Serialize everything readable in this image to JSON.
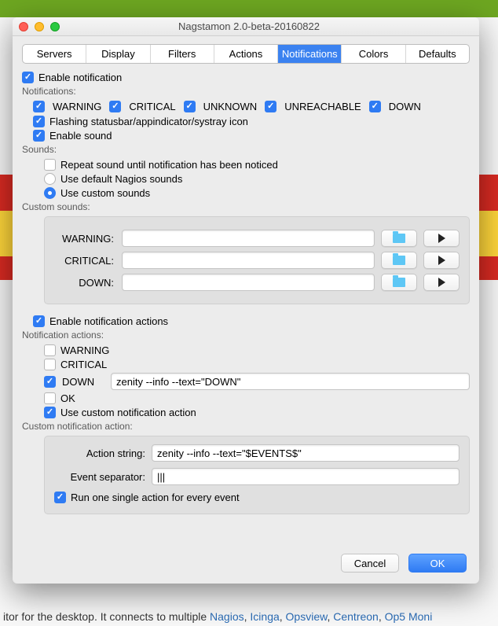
{
  "window_title": "Nagstamon 2.0-beta-20160822",
  "tabs": [
    "Servers",
    "Display",
    "Filters",
    "Actions",
    "Notifications",
    "Colors",
    "Defaults"
  ],
  "active_tab": "Notifications",
  "enable_notification": {
    "checked": true,
    "label": "Enable notification"
  },
  "notifications_header": "Notifications:",
  "levels": [
    {
      "key": "warning",
      "label": "WARNING",
      "checked": true
    },
    {
      "key": "critical",
      "label": "CRITICAL",
      "checked": true
    },
    {
      "key": "unknown",
      "label": "UNKNOWN",
      "checked": true
    },
    {
      "key": "unreachable",
      "label": "UNREACHABLE",
      "checked": true
    },
    {
      "key": "down",
      "label": "DOWN",
      "checked": true
    }
  ],
  "flashing": {
    "checked": true,
    "label": "Flashing statusbar/appindicator/systray icon"
  },
  "enable_sound": {
    "checked": true,
    "label": "Enable sound"
  },
  "sounds_header": "Sounds:",
  "repeat_sound": {
    "checked": false,
    "label": "Repeat sound until notification has been noticed"
  },
  "sound_mode": {
    "default": {
      "selected": false,
      "label": "Use default Nagios sounds"
    },
    "custom": {
      "selected": true,
      "label": "Use custom sounds"
    }
  },
  "custom_sounds_header": "Custom sounds:",
  "sounds": {
    "warning": {
      "label": "WARNING:",
      "value": ""
    },
    "critical": {
      "label": "CRITICAL:",
      "value": ""
    },
    "down": {
      "label": "DOWN:",
      "value": ""
    }
  },
  "enable_actions": {
    "checked": true,
    "label": "Enable notification actions"
  },
  "actions_header": "Notification actions:",
  "act_warning": {
    "checked": false,
    "label": "WARNING"
  },
  "act_critical": {
    "checked": false,
    "label": "CRITICAL"
  },
  "act_down": {
    "checked": true,
    "label": "DOWN",
    "value": "zenity --info --text=\"DOWN\""
  },
  "act_ok": {
    "checked": false,
    "label": "OK"
  },
  "use_custom_action": {
    "checked": true,
    "label": "Use custom notification action"
  },
  "custom_action_header": "Custom notification action:",
  "action_string": {
    "label": "Action string:",
    "value": "zenity --info --text=\"$EVENTS$\""
  },
  "event_separator": {
    "label": "Event separator:",
    "value": "|||"
  },
  "run_single": {
    "checked": true,
    "label": "Run one single action for every event"
  },
  "buttons": {
    "cancel": "Cancel",
    "ok": "OK"
  },
  "bg_text": {
    "pre": "itor for the desktop. It connects to multiple ",
    "links": [
      "Nagios",
      "Icinga",
      "Opsview",
      "Centreon",
      "Op5 Moni"
    ]
  }
}
